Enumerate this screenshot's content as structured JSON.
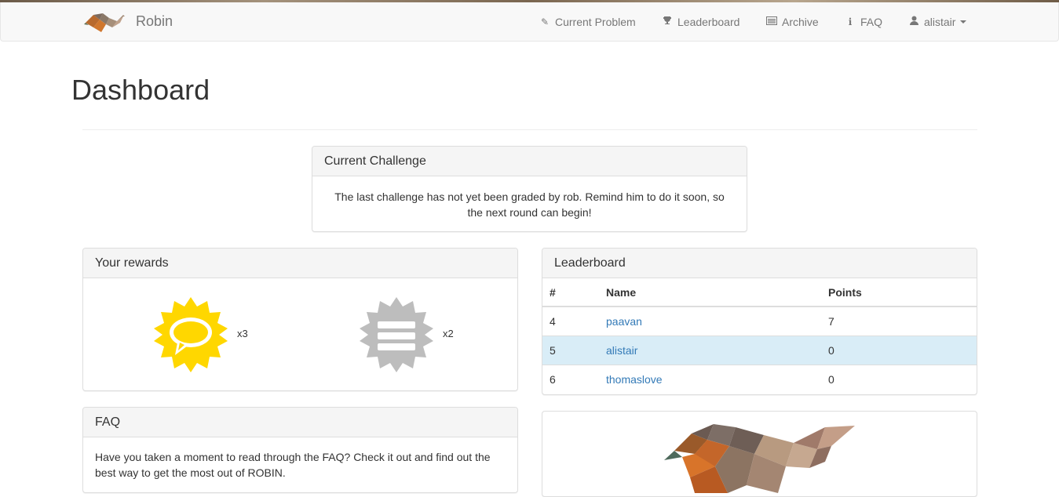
{
  "app": {
    "brand": "Robin"
  },
  "nav": {
    "items": [
      {
        "label": "Current Problem",
        "icon": "pencil-icon"
      },
      {
        "label": "Leaderboard",
        "icon": "trophy-icon"
      },
      {
        "label": "Archive",
        "icon": "list-icon"
      },
      {
        "label": "FAQ",
        "icon": "info-icon"
      }
    ],
    "user": {
      "label": "alistair",
      "icon": "user-icon"
    }
  },
  "page": {
    "title": "Dashboard"
  },
  "challenge": {
    "heading": "Current Challenge",
    "text": "The last challenge has not yet been graded by rob. Remind him to do it soon, so the next round can begin!"
  },
  "rewards": {
    "heading": "Your rewards",
    "items": [
      {
        "name": "speech-bubble-badge-icon",
        "color": "#ffd700",
        "count": "x3"
      },
      {
        "name": "lines-badge-icon",
        "color": "#bdbdbd",
        "count": "x2"
      }
    ]
  },
  "leaderboard": {
    "heading": "Leaderboard",
    "columns": [
      "#",
      "Name",
      "Points"
    ],
    "rows": [
      {
        "rank": "4",
        "name": "paavan",
        "points": "7"
      },
      {
        "rank": "5",
        "name": "alistair",
        "points": "0"
      },
      {
        "rank": "6",
        "name": "thomaslove",
        "points": "0"
      }
    ],
    "highlight_color": "#d9edf7"
  },
  "faq": {
    "heading": "FAQ",
    "text": "Have you taken a moment to read through the FAQ? Check it out and find out the best way to get the most out of ROBIN."
  },
  "colors": {
    "link": "#337ab7",
    "navbar_bg": "#f8f8f8",
    "badge_gold": "#ffd700",
    "badge_grey": "#bdbdbd"
  }
}
